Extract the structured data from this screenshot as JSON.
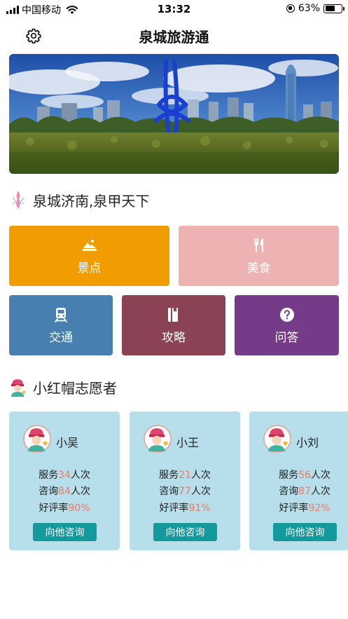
{
  "status_bar": {
    "carrier": "中国移动",
    "time": "13:32",
    "battery": "63%",
    "battery_level": 0.63
  },
  "nav": {
    "title": "泉城旅游通",
    "settings_icon": "gear-icon"
  },
  "banner": {
    "image": "city-fountain-sculpture-photo"
  },
  "slogan_section": {
    "title": "泉城济南,泉甲天下",
    "icon": "fountain-icon"
  },
  "tiles": [
    {
      "label": "景点",
      "icon": "mountain-photo-icon",
      "color": "#f19c00"
    },
    {
      "label": "美食",
      "icon": "fork-knife-icon",
      "color": "#edb3b3"
    },
    {
      "label": "交通",
      "icon": "train-icon",
      "color": "#467fb0"
    },
    {
      "label": "攻略",
      "icon": "book-icon",
      "color": "#8a4254"
    },
    {
      "label": "问答",
      "icon": "question-icon",
      "color": "#753a88"
    }
  ],
  "volunteer_section": {
    "title": "小红帽志愿者",
    "icon": "volunteer-icon"
  },
  "volunteers": [
    {
      "name": "小吴",
      "service_label": "服务",
      "service": "34",
      "service_unit": "人次",
      "consult_label": "咨询",
      "consult": "84",
      "consult_unit": "人次",
      "rating_label": "好评率",
      "rating": "90%",
      "button": "向他咨询"
    },
    {
      "name": "小王",
      "service_label": "服务",
      "service": "21",
      "service_unit": "人次",
      "consult_label": "咨询",
      "consult": "77",
      "consult_unit": "人次",
      "rating_label": "好评率",
      "rating": "91%",
      "button": "向他咨询"
    },
    {
      "name": "小刘",
      "service_label": "服务",
      "service": "56",
      "service_unit": "人次",
      "consult_label": "咨询",
      "consult": "87",
      "consult_unit": "人次",
      "rating_label": "好评率",
      "rating": "92%",
      "button": "向他咨询"
    }
  ],
  "colors": {
    "accent_number": "#ef7b66",
    "card_bg": "#b7deeb",
    "button_bg": "#14999d"
  }
}
